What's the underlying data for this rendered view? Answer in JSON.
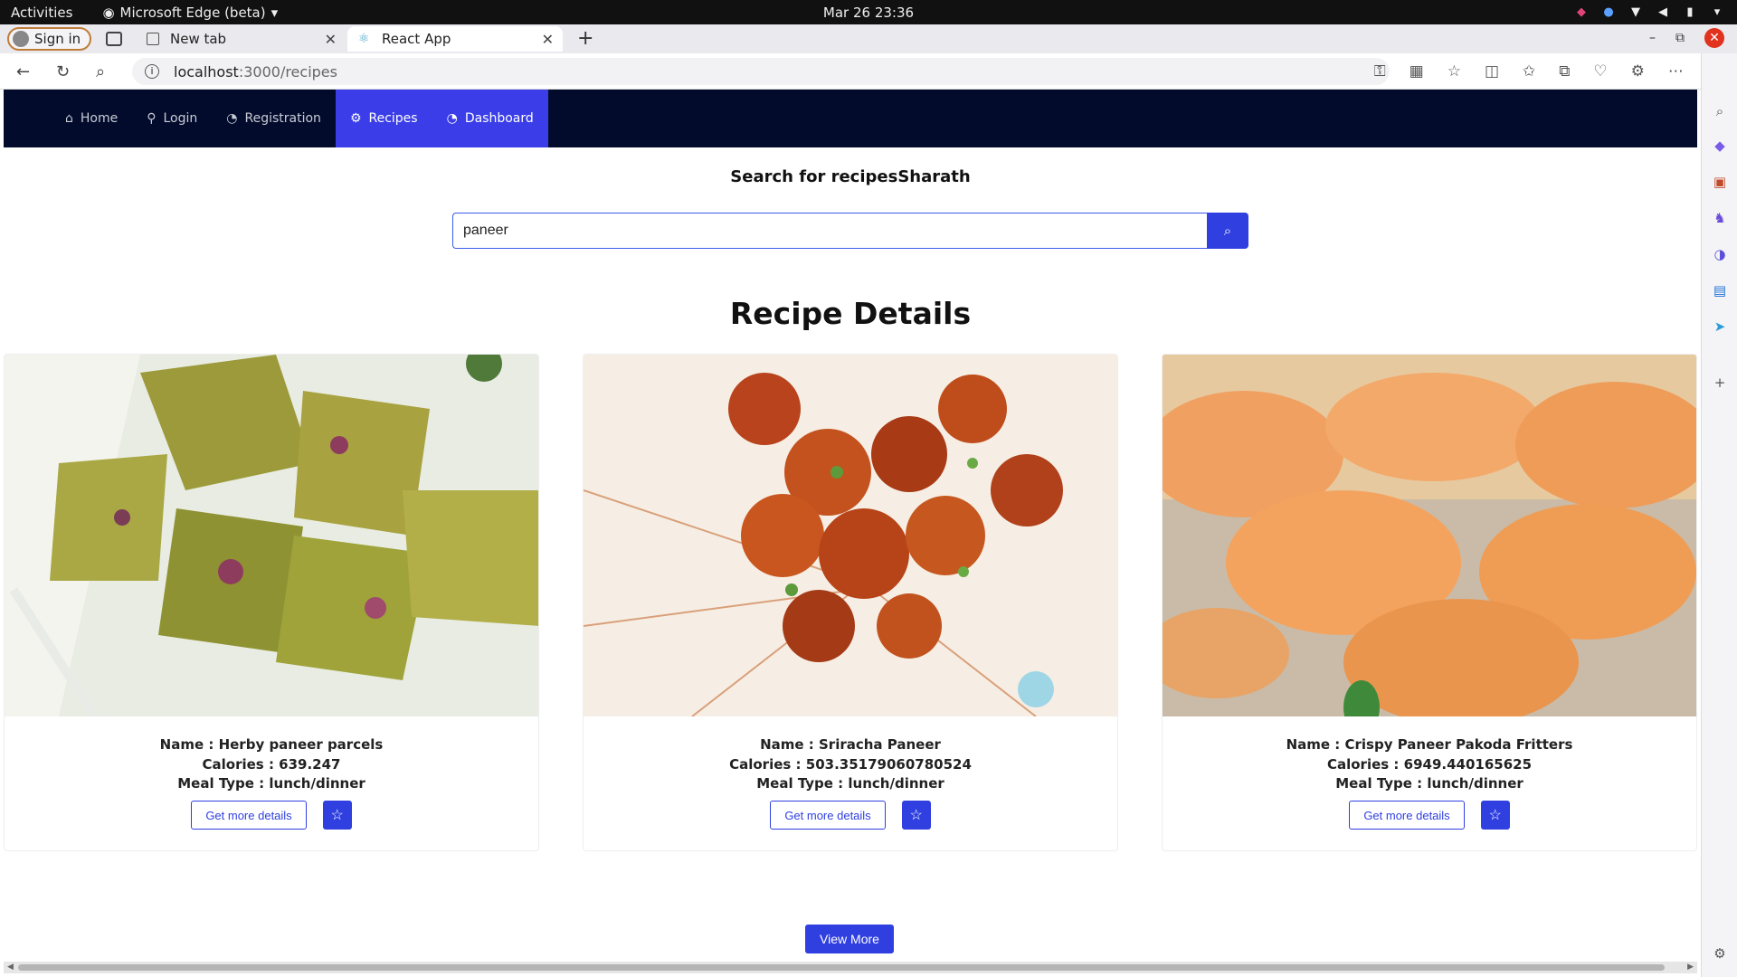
{
  "os": {
    "activities": "Activities",
    "app_name": "Microsoft Edge (beta)",
    "clock": "Mar 26  23:36"
  },
  "browser": {
    "sign_in": "Sign in",
    "tabs": [
      {
        "label": "New tab"
      },
      {
        "label": "React App"
      }
    ],
    "url_host": "localhost",
    "url_path": ":3000/recipes"
  },
  "nav": {
    "items": [
      {
        "label": "Home",
        "icon": "home-icon"
      },
      {
        "label": "Login",
        "icon": "user-icon"
      },
      {
        "label": "Registration",
        "icon": "gauge-icon"
      },
      {
        "label": "Recipes",
        "icon": "gear-icon"
      },
      {
        "label": "Dashboard",
        "icon": "gauge-icon"
      }
    ],
    "active": "Recipes"
  },
  "search": {
    "title": "Search for recipesSharath",
    "value": "paneer"
  },
  "section_title": "Recipe Details",
  "recipes": [
    {
      "name": "Name : Herby paneer parcels",
      "calories": "Calories : 639.247",
      "meal_type": "Meal Type : lunch/dinner",
      "details_label": "Get more details"
    },
    {
      "name": "Name : Sriracha Paneer",
      "calories": "Calories : 503.35179060780524",
      "meal_type": "Meal Type : lunch/dinner",
      "details_label": "Get more details"
    },
    {
      "name": "Name : Crispy Paneer Pakoda Fritters",
      "calories": "Calories : 6949.440165625",
      "meal_type": "Meal Type : lunch/dinner",
      "details_label": "Get more details"
    }
  ],
  "view_more": "View More",
  "colors": {
    "navbar": "#020b2b",
    "accent": "#2f3fe0"
  }
}
